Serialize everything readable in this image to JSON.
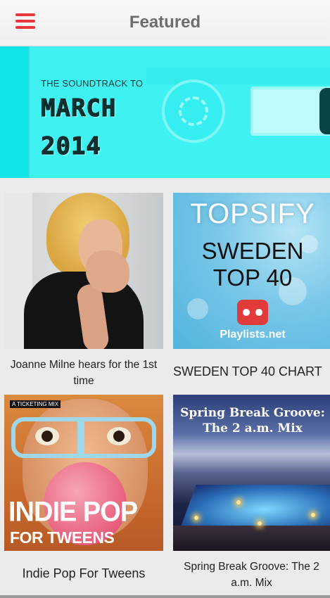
{
  "header": {
    "title": "Featured",
    "menu_icon": "hamburger-menu-icon",
    "accent_color": "#e8383d"
  },
  "banner": {
    "subtitle": "THE SOUNDTRACK TO",
    "title_line1": "MARCH",
    "title_line2": "2014",
    "background_color": "#17e9ea"
  },
  "playlists": [
    {
      "caption": "Joanne Milne hears for the 1st time"
    },
    {
      "caption": "SWEDEN TOP 40 CHART",
      "art": {
        "title": "TOPSIFY",
        "line1": "SWEDEN",
        "line2": "TOP 40",
        "brand": "Playlists.net"
      }
    },
    {
      "caption": "Indie Pop For Tweens",
      "art": {
        "tag": "A TICKETING MIX",
        "title": "INDIE POP",
        "subtitle": "FOR TWEENS"
      }
    },
    {
      "caption": "Spring Break Groove: The 2 a.m. Mix",
      "art": {
        "line1": "Spring Break Groove:",
        "line2": "The 2 a.m. Mix"
      }
    }
  ]
}
